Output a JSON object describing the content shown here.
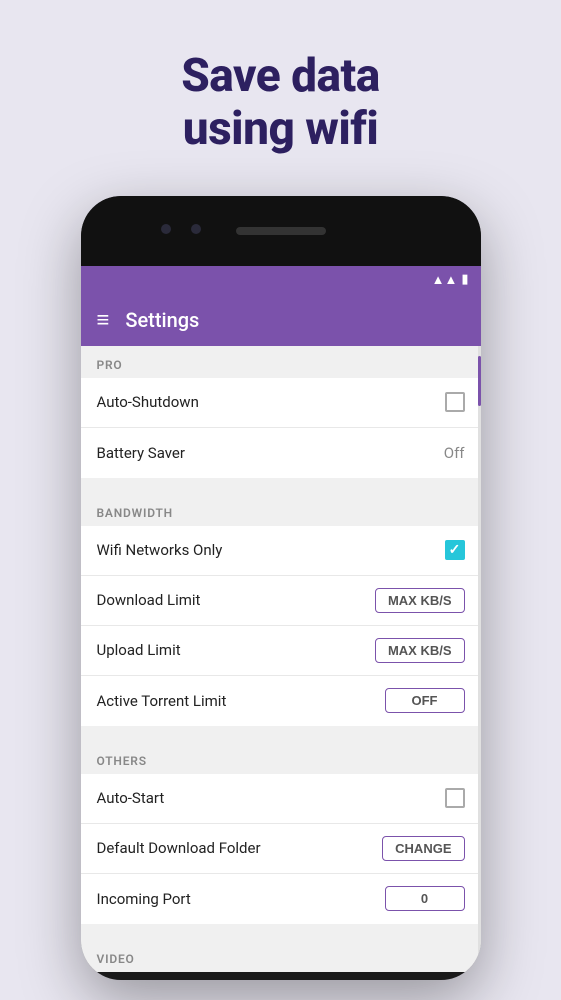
{
  "headline": {
    "line1": "Save data",
    "line2": "using wifi"
  },
  "status_bar": {
    "wifi": "▲",
    "signal": "▲",
    "battery": "▮"
  },
  "app_bar": {
    "menu_icon": "≡",
    "title": "Settings"
  },
  "sections": [
    {
      "id": "pro",
      "header": "PRO",
      "rows": [
        {
          "label": "Auto-Shutdown",
          "control": "checkbox",
          "value": false
        },
        {
          "label": "Battery Saver",
          "control": "text",
          "value": "Off"
        }
      ]
    },
    {
      "id": "bandwidth",
      "header": "BANDWIDTH",
      "rows": [
        {
          "label": "Wifi Networks Only",
          "control": "checkbox",
          "value": true
        },
        {
          "label": "Download Limit",
          "control": "button",
          "value": "MAX KB/S"
        },
        {
          "label": "Upload Limit",
          "control": "button",
          "value": "MAX KB/S"
        },
        {
          "label": "Active Torrent Limit",
          "control": "button",
          "value": "OFF"
        }
      ]
    },
    {
      "id": "others",
      "header": "OTHERS",
      "rows": [
        {
          "label": "Auto-Start",
          "control": "checkbox",
          "value": false
        },
        {
          "label": "Default Download Folder",
          "control": "button",
          "value": "CHANGE"
        },
        {
          "label": "Incoming Port",
          "control": "button",
          "value": "0"
        }
      ]
    },
    {
      "id": "video",
      "header": "VIDEO",
      "rows": []
    }
  ]
}
